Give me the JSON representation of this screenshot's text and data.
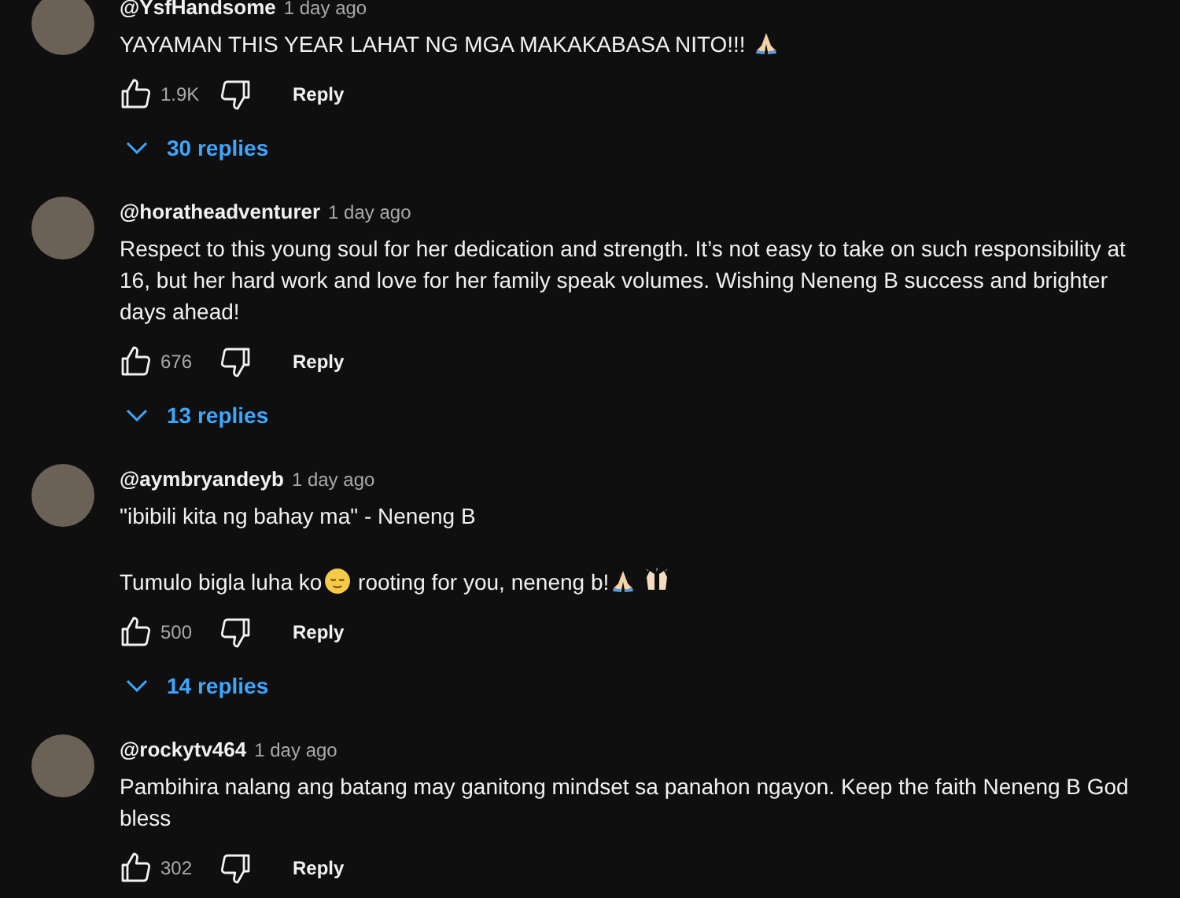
{
  "comments": [
    {
      "username": "@YsfHandsome",
      "time": "1 day ago",
      "body": [
        [
          {
            "kind": "text",
            "text": "YAYAMAN THIS YEAR LAHAT NG MGA MAKAKABASA NITO!!! "
          },
          {
            "kind": "pray"
          }
        ]
      ],
      "likes": "1.9K",
      "reply_label": "Reply",
      "replies": "30 replies"
    },
    {
      "username": "@horatheadventurer",
      "time": "1 day ago",
      "body": [
        [
          {
            "kind": "text",
            "text": "Respect to this young soul for her dedication and strength. It’s not easy to take on such responsibility at 16, but her hard work and love for her family speak volumes. Wishing Neneng B success and brighter days ahead!"
          }
        ]
      ],
      "likes": "676",
      "reply_label": "Reply",
      "replies": "13 replies"
    },
    {
      "username": "@aymbryandeyb",
      "time": "1 day ago",
      "body": [
        [
          {
            "kind": "text",
            "text": "\"ibibili kita ng bahay ma\" - Neneng B"
          }
        ],
        [
          {
            "kind": "text",
            "text": "Tumulo bigla luha ko"
          },
          {
            "kind": "relieved"
          },
          {
            "kind": "text",
            "text": " rooting for you, neneng b!"
          },
          {
            "kind": "pray"
          },
          {
            "kind": "raised-hands"
          }
        ]
      ],
      "likes": "500",
      "reply_label": "Reply",
      "replies": "14 replies"
    },
    {
      "username": "@rockytv464",
      "time": "1 day ago",
      "body": [
        [
          {
            "kind": "text",
            "text": "Pambihira nalang ang batang may ganitong mindset sa panahon ngayon. Keep the faith Neneng B God bless"
          }
        ]
      ],
      "likes": "302",
      "reply_label": "Reply"
    }
  ]
}
